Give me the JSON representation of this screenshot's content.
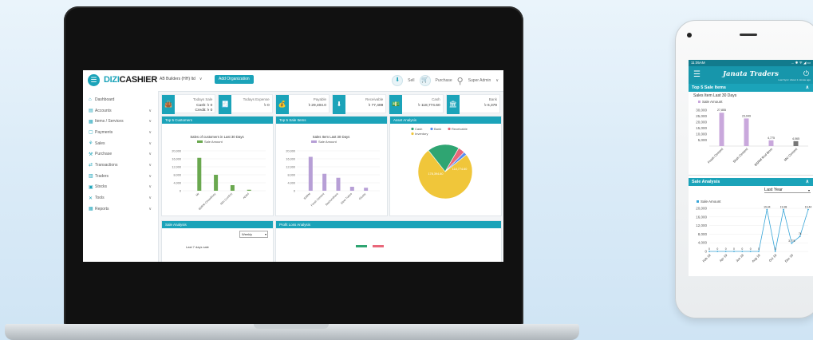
{
  "app": {
    "logo_prefix": "DIZI",
    "logo_suffix": "CASHIER",
    "org_name": "AB Builders (HH) ltd",
    "add_org_label": "Add Organization",
    "sell_label": "Sell",
    "purchase_label": "Purchase",
    "user_label": "Super Admin"
  },
  "sidebar": {
    "items": [
      {
        "label": "Dashboard",
        "icon": "home-icon",
        "has_children": false
      },
      {
        "label": "Accounts",
        "icon": "accounts-icon",
        "has_children": true
      },
      {
        "label": "Items / Services",
        "icon": "items-icon",
        "has_children": true
      },
      {
        "label": "Payments",
        "icon": "payments-icon",
        "has_children": true
      },
      {
        "label": "Sales",
        "icon": "sales-icon",
        "has_children": true
      },
      {
        "label": "Purchase",
        "icon": "purchase-icon",
        "has_children": true
      },
      {
        "label": "Transactions",
        "icon": "transactions-icon",
        "has_children": true
      },
      {
        "label": "Traders",
        "icon": "traders-icon",
        "has_children": true
      },
      {
        "label": "Stocks",
        "icon": "stocks-icon",
        "has_children": true
      },
      {
        "label": "Tools",
        "icon": "tools-icon",
        "has_children": true
      },
      {
        "label": "Reports",
        "icon": "reports-icon",
        "has_children": true
      }
    ]
  },
  "stats": [
    {
      "title": "Todays Sale",
      "value_lines": [
        "Cash: ৳ 0",
        "Credit: ৳ 0"
      ],
      "icon": "shopping-bag-icon"
    },
    {
      "title": "Todays Expense",
      "value_lines": [
        "৳ 0"
      ],
      "icon": "receipt-icon"
    },
    {
      "title": "Payable",
      "value_lines": [
        "৳ 29,404.0"
      ],
      "icon": "money-bag-icon"
    },
    {
      "title": "Receivable",
      "value_lines": [
        "৳ 77,489"
      ],
      "icon": "hand-money-icon"
    },
    {
      "title": "Cash",
      "value_lines": [
        "৳ 118,774.60"
      ],
      "icon": "cash-icon"
    },
    {
      "title": "Bank",
      "value_lines": [
        "৳ 6,379"
      ],
      "icon": "bank-icon"
    }
  ],
  "panels": {
    "top_customers": "Top 5 Customers",
    "top_sale_items": "Top 5 Sale Items",
    "asset_analysis": "Asset Analysis",
    "sale_analysis": "Sale Analysis",
    "profit_loss": "Profit Loss Analysis",
    "sale_analysis_filter": "Weekly",
    "sale_analysis_note": "Last 7 days sale"
  },
  "phone": {
    "time": "11:05AM",
    "status_icons": "... ✱ ᯤ ◢ ▭",
    "brand": "Janata Traders",
    "brand_sub": "Last Sync: About 1 minute ago",
    "section1": "Top 5 Sale Items",
    "section1_sub": "Sales Item Last 30 Days",
    "section2": "Sale Analysis",
    "section2_filter": "Last Year"
  },
  "chart_data": [
    {
      "type": "bar",
      "title": "Sales of customers in Last 30 Days",
      "series": [
        {
          "name": "Sale Amount",
          "values": [
            16500,
            8000,
            2800,
            500
          ]
        }
      ],
      "categories": [
        "Mr",
        "BSRM Chowdhury",
        "MAI Comfort",
        "Abdul"
      ],
      "ylabel": "",
      "yticks": [
        0,
        4000,
        8000,
        12000,
        16000,
        20000
      ],
      "ylim": [
        0,
        20000
      ],
      "color": "#6aa84f"
    },
    {
      "type": "bar",
      "title": "Sales Item Last 30 Days",
      "series": [
        {
          "name": "Sale Amount",
          "values": [
            17000,
            8500,
            6500,
            2000,
            1500
          ]
        }
      ],
      "categories": [
        "BSRM",
        "Fresh Cement",
        "Bashundhara",
        "Steel Tubes",
        "Glossy"
      ],
      "ylabel": "",
      "yticks": [
        0,
        4000,
        8000,
        12000,
        16000,
        20000
      ],
      "ylim": [
        0,
        20000
      ],
      "color": "#b79fd6"
    },
    {
      "type": "pie",
      "legend": [
        "Cash",
        "Bank",
        "Receivable",
        "Inventory"
      ],
      "slices": [
        {
          "label": "Inventory",
          "value": 75,
          "color": "#f0c63a"
        },
        {
          "label": "Cash",
          "value": 19,
          "color": "#2fa572"
        },
        {
          "label": "Receivable",
          "value": 4,
          "color": "#e9677a"
        },
        {
          "label": "Bank",
          "value": 2,
          "color": "#5b8ff0"
        }
      ],
      "data_labels": [
        "178,394.80",
        "118,774.60"
      ]
    },
    {
      "type": "bar",
      "title": "Sales Item Last 30 Days",
      "series": [
        {
          "name": "Sale Amount",
          "values": [
            27855,
            23049,
            4775,
            4065
          ]
        }
      ],
      "value_labels": [
        "27,855",
        "23,049",
        "4,775",
        "4,065"
      ],
      "categories": [
        "Fresh Cement",
        "Shah Cement",
        "BSRM Rod 8mm",
        "MU Cement"
      ],
      "yticks": [
        5000,
        10000,
        15000,
        20000,
        25000,
        30000
      ],
      "ylim": [
        0,
        32000
      ],
      "colors": [
        "#c9a8dc",
        "#c9a8dc",
        "#c9a8dc",
        "#777777"
      ]
    },
    {
      "type": "line",
      "series": [
        {
          "name": "Sale Amount",
          "values": [
            0,
            0,
            0,
            0,
            0,
            0,
            0,
            19440,
            0,
            19440,
            3776,
            7000,
            19440
          ]
        }
      ],
      "value_labels": [
        "0",
        "0",
        "0",
        "0",
        "0",
        "0",
        "0",
        "19,44",
        "0",
        "19,38",
        "3,776",
        "7k",
        "19,44"
      ],
      "categories": [
        "Feb 19",
        "",
        "Apr 19",
        "",
        "Jun 19",
        "",
        "Aug 19",
        "",
        "Oct 19",
        "",
        "Dec 19",
        "",
        ""
      ],
      "yticks": [
        0,
        4000,
        8000,
        12000,
        16000,
        20000
      ],
      "ylim": [
        0,
        20000
      ],
      "color": "#3aa6d8"
    }
  ]
}
